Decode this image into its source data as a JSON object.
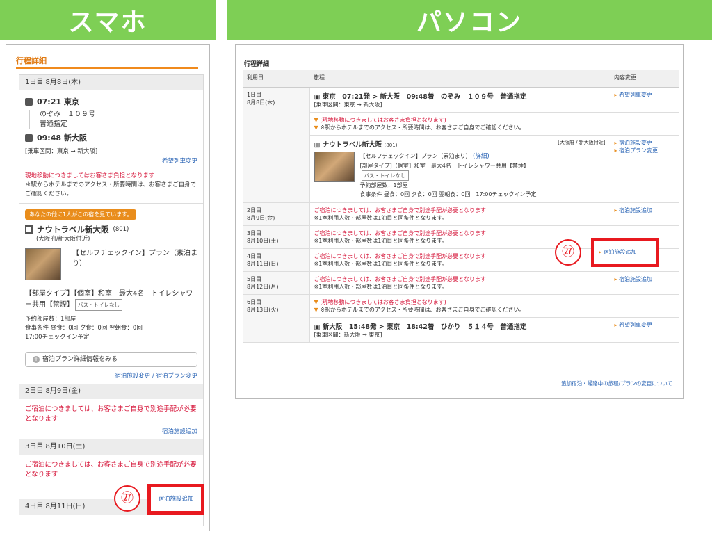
{
  "banners": {
    "sp": "スマホ",
    "pc": "パソコン"
  },
  "sp": {
    "section_title": "行程詳細",
    "day1_head": "1日目 8月8日(木)",
    "dep_time": "07:21 東京",
    "train_name": "のぞみ　１０９号",
    "train_seat": "普通指定",
    "arr_time": "09:48 新大阪",
    "route": "[乗車区間：東京 → 新大阪]",
    "change_train": "希望列車変更",
    "move_note_red": "現地移動につきましてはお客さま負担となります",
    "move_note": "＊駅からホテルまでのアクセス・所要時間は、お客さまご自身でご確認ください。",
    "viewers_tag": "あなたの他に1人がこの宿を見ています。",
    "hotel_name": "ナウトラベル新大阪",
    "hotel_code": "(801)",
    "hotel_area": "(大阪府/新大阪付近)",
    "plan_title": "【セルフチェックイン】プラン（素泊まり）",
    "room_type": "【部屋タイプ】【個室】和室　最大4名　トイレシャワー共用【禁煙】",
    "room_badge": "バス・トイレなし",
    "rooms": "予約部屋数：1部屋",
    "meals": "食事条件 昼食：0回 夕食：0回 翌朝食：0回",
    "checkin": "17:00チェックイン予定",
    "plan_detail_btn": "宿泊プラン詳細情報をみる",
    "hotel_change": "宿泊施設変更",
    "sep": "/",
    "plan_change": "宿泊プラン変更",
    "day2_head": "2日目 8月9日(金)",
    "stay_note": "ご宿泊につきましては、お客さまご自身で別途手配が必要となります",
    "add_hotel": "宿泊施設追加",
    "day3_head": "3日目 8月10日(土)",
    "day4_head": "4日目 8月11日(日)",
    "marker": "㉗"
  },
  "pc": {
    "section_title": "行程詳細",
    "cols": [
      "利用日",
      "旅程",
      "内容変更"
    ],
    "day1": [
      "1日目",
      "8月8日(木)"
    ],
    "train1": "東京　07:21発 > 新大阪　09:48着　のぞみ　１０９号　普通指定",
    "route1": "[乗車区間：東京 → 新大阪]",
    "change_train": "希望列車変更",
    "move_red": "(現地移動につきましてはお客さま負担となります)",
    "move_note": "※駅からホテルまでのアクセス・所要時間は、お客さまご自身でご確認ください。",
    "hotel": "ナウトラベル新大阪",
    "hotel_code": "(801)",
    "hotel_area": "[大阪府 / 新大阪付近]",
    "hotel_change": "宿泊施設変更",
    "plan_change": "宿泊プラン変更",
    "plan": "【セルフチェックイン】プラン（素泊まり）",
    "plan_more": "(詳細)",
    "room": "[部屋タイプ]【個室】和室　最大4名　トイレシャワー共用【禁煙】",
    "badge": "バス・トイレなし",
    "rooms": "予約部屋数：1部屋",
    "meals": "食事条件 昼食：0回 夕食：0回 翌朝食：0回　17:00チェックイン予定",
    "stay_red": "ご宿泊につきましては、お客さまご自身で別途手配が必要となります",
    "stay_note": "※1室利用人数・部屋数は1泊目と同条件となります。",
    "add_hotel": "宿泊施設追加",
    "day2": [
      "2日目",
      "8月9日(金)"
    ],
    "day3": [
      "3日目",
      "8月10日(土)"
    ],
    "day4": [
      "4日目",
      "8月11日(日)"
    ],
    "day5": [
      "5日目",
      "8月12日(月)"
    ],
    "day6": [
      "6日目",
      "8月13日(火)"
    ],
    "train2": "新大阪　15:48発 > 東京　18:42着　ひかり　５１４号　普通指定",
    "route2": "[乗車区間：新大阪 → 東京]",
    "footer_link": "追加宿泊・帰路中の旅程/プランの変更について",
    "marker": "㉗"
  },
  "colors": {
    "accent": "#f08a1c",
    "banner": "#7ecf55",
    "highlight": "#e8191f",
    "link": "#2a64b5",
    "alert": "#d6173b"
  }
}
